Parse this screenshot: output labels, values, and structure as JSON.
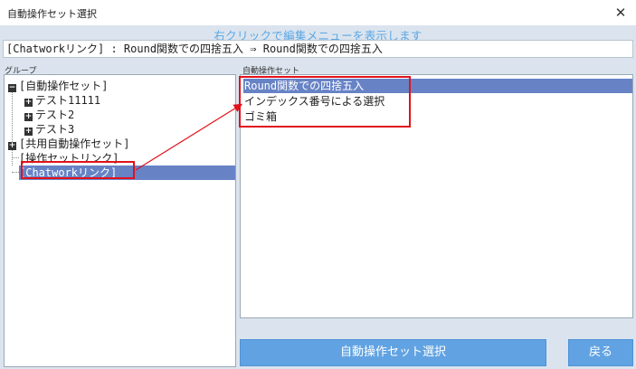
{
  "window": {
    "title": "自動操作セット選択",
    "close_glyph": "✕"
  },
  "hint": "右クリックで編集メニューを表示します",
  "path_bar": "[Chatworkリンク] : Round関数での四捨五入 ⇒ Round関数での四捨五入",
  "group_panel": {
    "label": "グループ",
    "items": [
      {
        "label": "[自動操作セット]",
        "toggle": "−"
      },
      {
        "label": "テスト11111",
        "toggle": "+"
      },
      {
        "label": "テスト2",
        "toggle": "+"
      },
      {
        "label": "テスト3",
        "toggle": "+"
      },
      {
        "label": "[共用自動操作セット]",
        "toggle": "+"
      },
      {
        "label": "[操作セットリンク]",
        "toggle": ""
      },
      {
        "label": "[Chatworkリンク]",
        "toggle": ""
      }
    ],
    "selected_index": 6
  },
  "sets_panel": {
    "label": "自動操作セット",
    "items": [
      "Round関数での四捨五入",
      "インデックス番号による選択",
      "ゴミ箱"
    ],
    "selected_index": 0
  },
  "buttons": {
    "select": "自動操作セット選択",
    "back": "戻る"
  },
  "colors": {
    "background": "#dbe4ee",
    "hint_text": "#5aa7e6",
    "selection": "#6783c6",
    "button": "#61a3e2",
    "annotation": "#e0121b"
  }
}
